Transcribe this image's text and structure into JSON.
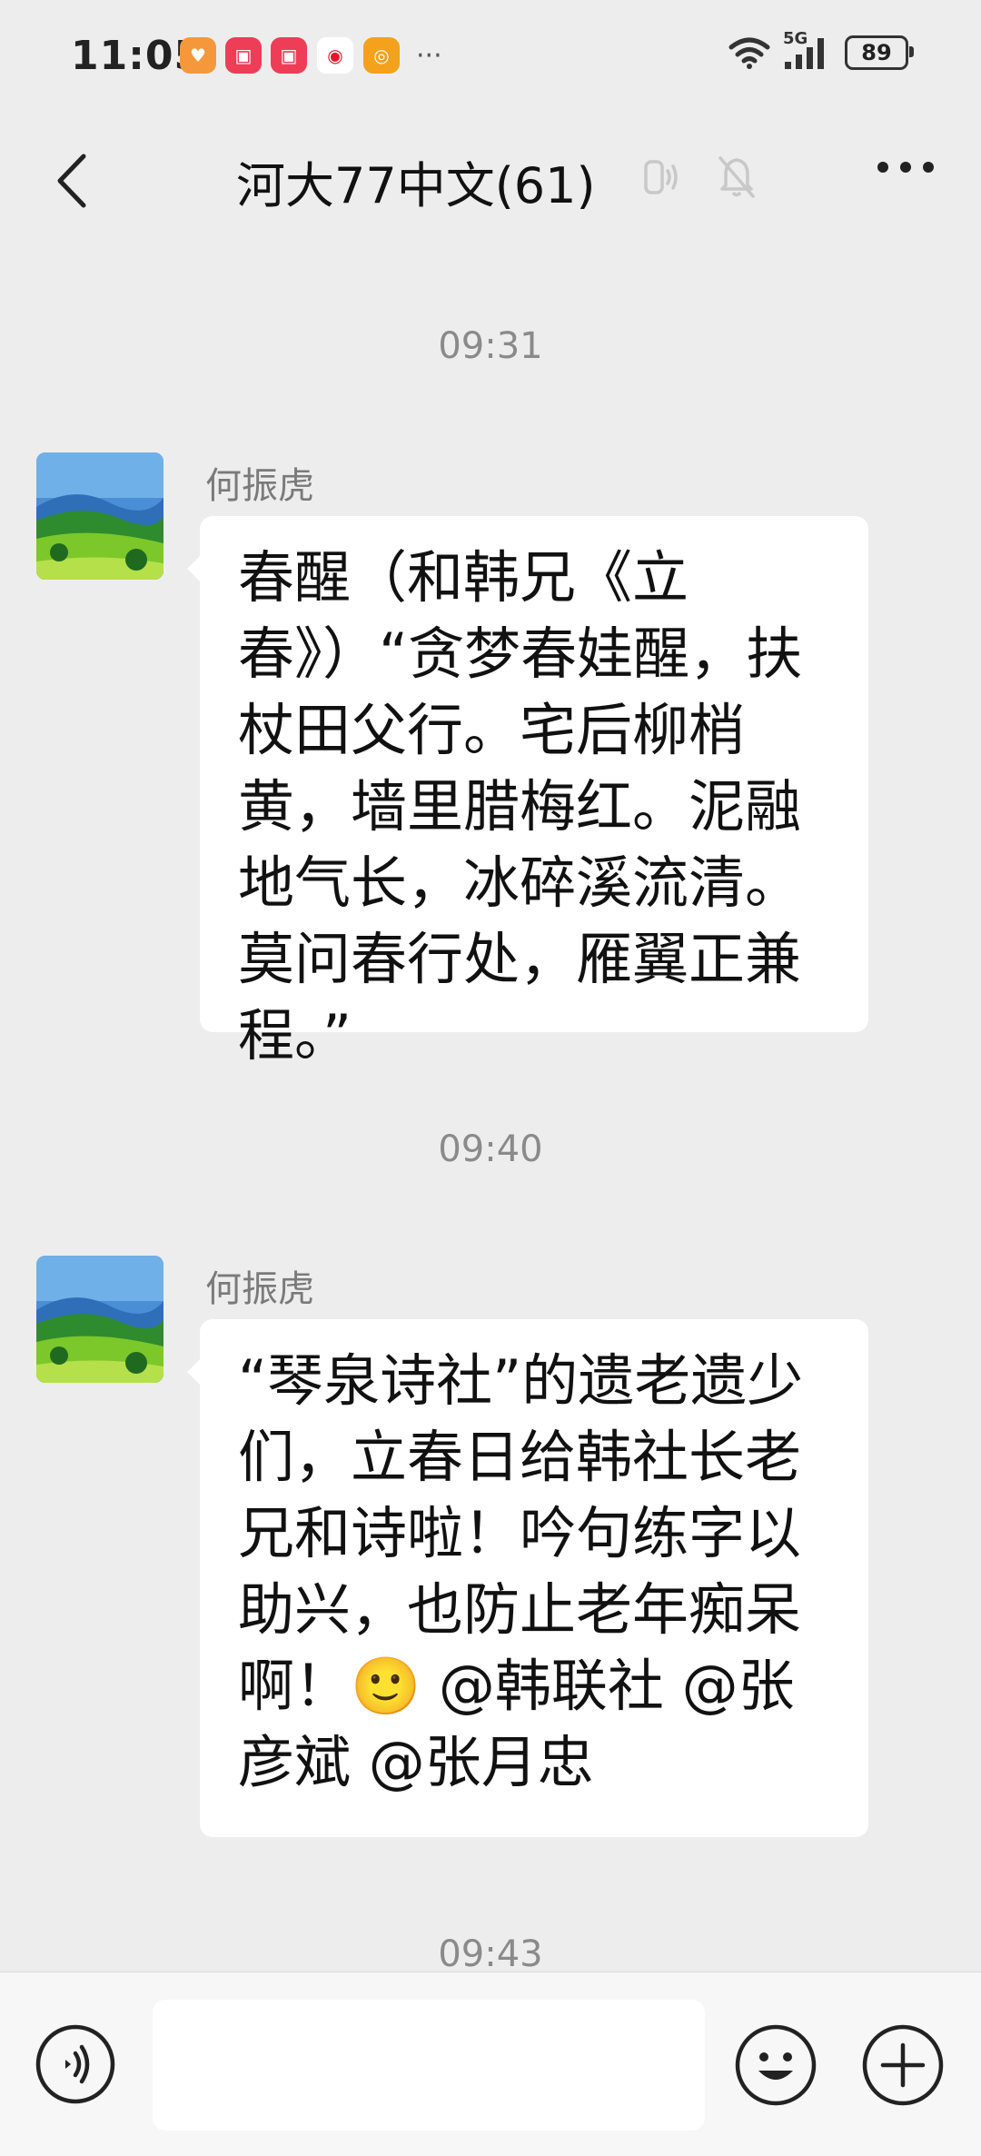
{
  "status_bar": {
    "time": "11:05",
    "network": "5G",
    "battery": "89",
    "overflow": "···"
  },
  "header": {
    "title": "河大77中文(61)"
  },
  "messages": [
    {
      "time": "09:31",
      "sender": "何振虎",
      "text": "春醒（和韩兄《立春》）“贪梦春娃醒，扶杖田父行。宅后柳梢黄，墙里腊梅红。泥融地气长，冰碎溪流清。莫问春行处，雁翼正兼程。”"
    },
    {
      "time": "09:40",
      "sender": "何振虎",
      "text": "“琴泉诗社”的遗老遗少们，立春日给韩社长老兄和诗啦！吟句练字以助兴，也防止老年痴呆啊！🙂 @韩联社 @张彦斌 @张月忠"
    },
    {
      "time": "09:43"
    }
  ],
  "input": {
    "value": ""
  },
  "colors": {
    "background": "#ededed",
    "bubble": "#ffffff",
    "timestamp": "#8a8a8a"
  }
}
